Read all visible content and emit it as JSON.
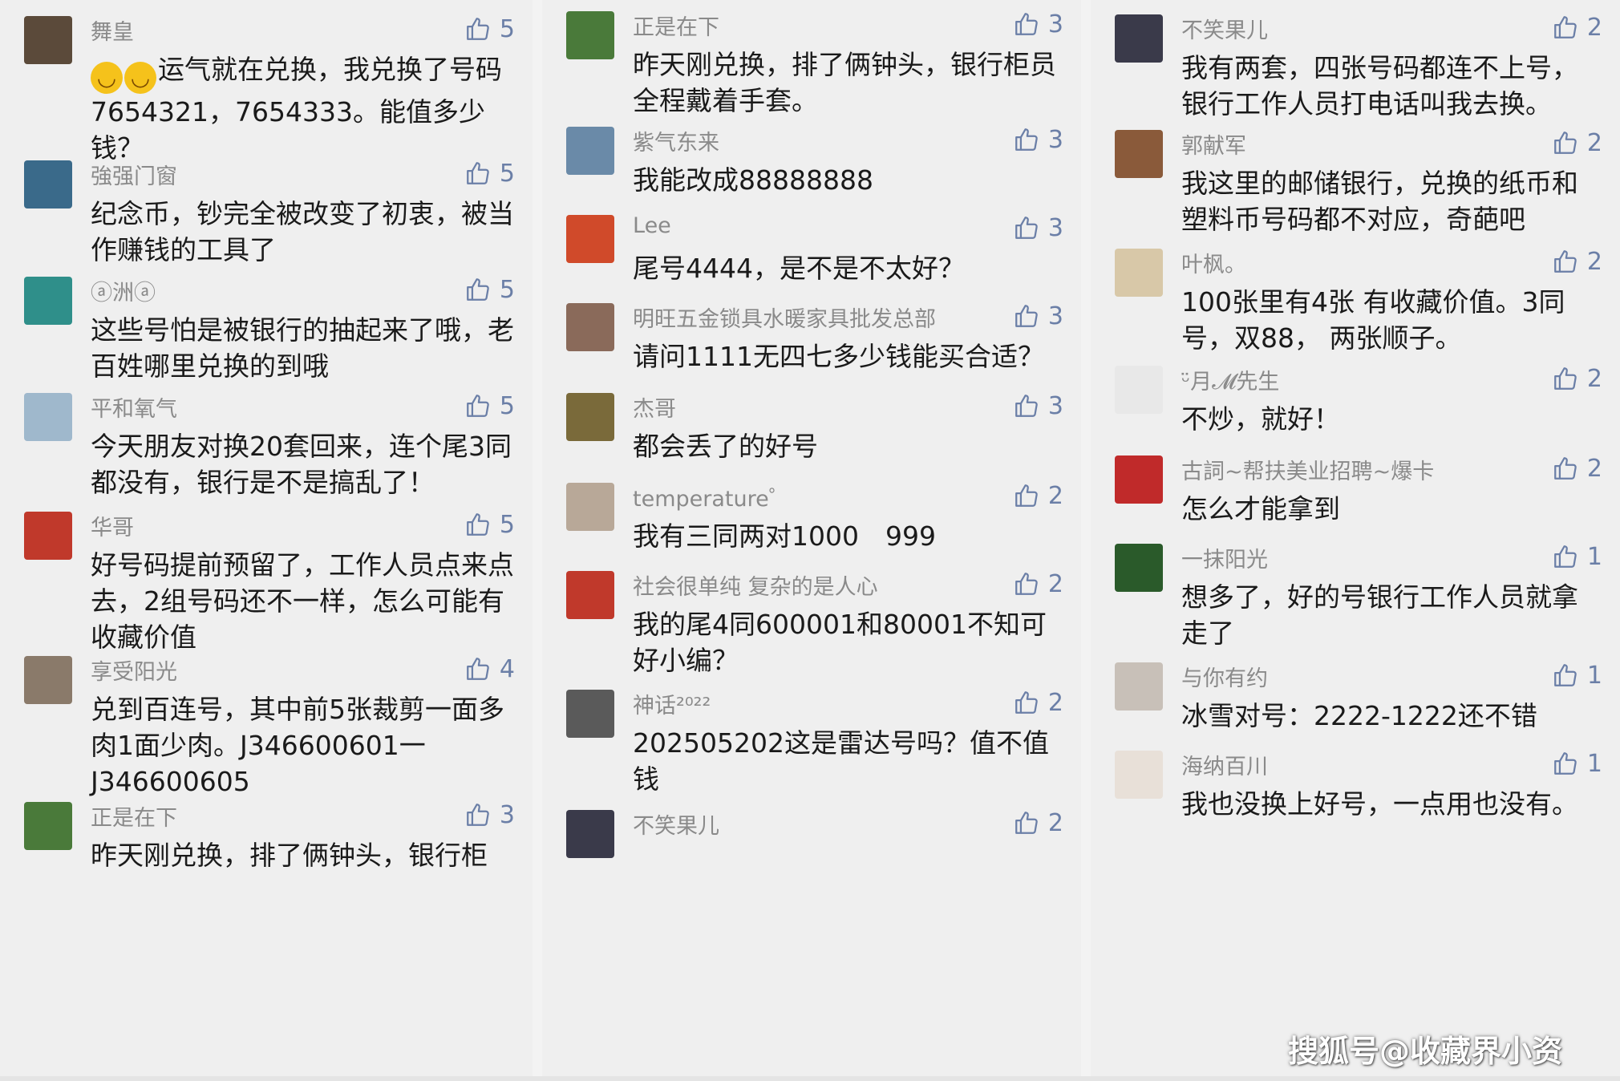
{
  "columns": [
    {
      "comments": [
        {
          "user": "舞皇",
          "likes": "5",
          "text": "运气就在兑换，我兑换了号码7654321，7654333。能值多少钱？",
          "emojis": 2,
          "avatar_color": "#5b4a3a"
        },
        {
          "user": "強强门窗",
          "likes": "5",
          "text": "纪念币，钞完全被改变了初衷，被当作赚钱的工具了",
          "avatar_color": "#3a6a8a"
        },
        {
          "user": "ⓐ洲ⓐ",
          "likes": "5",
          "text": "这些号怕是被银行的抽起来了哦，老百姓哪里兑换的到哦",
          "avatar_color": "#2f8f8a"
        },
        {
          "user": "平和氧气",
          "likes": "5",
          "text": "今天朋友对换20套回来，连个尾3同都没有，银行是不是搞乱了！",
          "avatar_color": "#9fb8cc"
        },
        {
          "user": "华哥",
          "likes": "5",
          "text": "好号码提前预留了，工作人员点来点去，2组号码还不一样，怎么可能有收藏价值",
          "avatar_color": "#c0392b"
        },
        {
          "user": "享受阳光",
          "likes": "4",
          "text": "兑到百连号，其中前5张裁剪一面多肉1面少肉。J346600601一J346600605",
          "avatar_color": "#8a7a6a"
        },
        {
          "user": "正是在下",
          "likes": "3",
          "text": "昨天刚兑换，排了俩钟头，银行柜",
          "avatar_color": "#4a7a3a"
        }
      ]
    },
    {
      "comments": [
        {
          "user": "正是在下",
          "likes": "3",
          "text": "昨天刚兑换，排了俩钟头，银行柜员全程戴着手套。",
          "avatar_color": "#4a7a3a"
        },
        {
          "user": "紫气东来",
          "likes": "3",
          "text": "我能改成88888888",
          "avatar_color": "#6a8aa8"
        },
        {
          "user": "Lee",
          "likes": "3",
          "text": "尾号4444，是不是不太好？",
          "avatar_color": "#d04a2a"
        },
        {
          "user": "明旺五金锁具水暖家具批发总部",
          "likes": "3",
          "text": "请问1111无四七多少钱能买合适？",
          "avatar_color": "#8a6a5a"
        },
        {
          "user": "杰哥",
          "likes": "3",
          "text": "都会丢了的好号",
          "avatar_color": "#7a6a3a"
        },
        {
          "user": "temperature゜",
          "likes": "2",
          "text": "我有三同两对1000　999",
          "avatar_color": "#b8a898"
        },
        {
          "user": "社会很单纯 复杂的是人心",
          "likes": "2",
          "text": "我的尾4同600001和80001不知可好小编？",
          "avatar_color": "#c0392b"
        },
        {
          "user": "神话²⁰²²",
          "likes": "2",
          "text": "202505202这是雷达号吗？值不值钱",
          "avatar_color": "#5a5a5a"
        },
        {
          "user": "不笑果儿",
          "likes": "2",
          "text": "",
          "avatar_color": "#3a3a4a"
        }
      ]
    },
    {
      "comments": [
        {
          "user": "不笑果儿",
          "likes": "2",
          "text": "我有两套，四张号码都连不上号，银行工作人员打电话叫我去换。",
          "avatar_color": "#3a3a4a"
        },
        {
          "user": "郭献军",
          "likes": "2",
          "text": "我这里的邮储银行，兑换的纸币和塑料币号码都不对应，奇葩吧",
          "avatar_color": "#8a5a3a"
        },
        {
          "user": "叶枫。",
          "likes": "2",
          "text": "100张里有4张 有收藏价值。3同号，双88， 两张顺子。",
          "avatar_color": "#d8c8a8"
        },
        {
          "user": "ᵕ̈月𝓜先生",
          "likes": "2",
          "text": "不炒，就好！",
          "avatar_color": "#e8e8e8"
        },
        {
          "user": "古詞~帮扶美业招聘~爆卡",
          "likes": "2",
          "text": "怎么才能拿到",
          "avatar_color": "#c02a2a"
        },
        {
          "user": "一抹阳光",
          "likes": "1",
          "text": "想多了，好的号银行工作人员就拿走了",
          "avatar_color": "#2a5a2a"
        },
        {
          "user": "与你有约",
          "likes": "1",
          "text": "冰雪对号：2222-1222还不错",
          "avatar_color": "#c8c0b8"
        },
        {
          "user": "海纳百川",
          "likes": "1",
          "text": "我也没换上好号，一点用也没有。",
          "avatar_color": "#e8e0d8"
        }
      ]
    }
  ],
  "watermark": "搜狐号@收藏界小资",
  "colors": {
    "like": "#6b7fa7",
    "username": "#8a8a8a",
    "text": "#1a1a1a"
  },
  "icons": {
    "like": "thumbs-up-icon"
  }
}
